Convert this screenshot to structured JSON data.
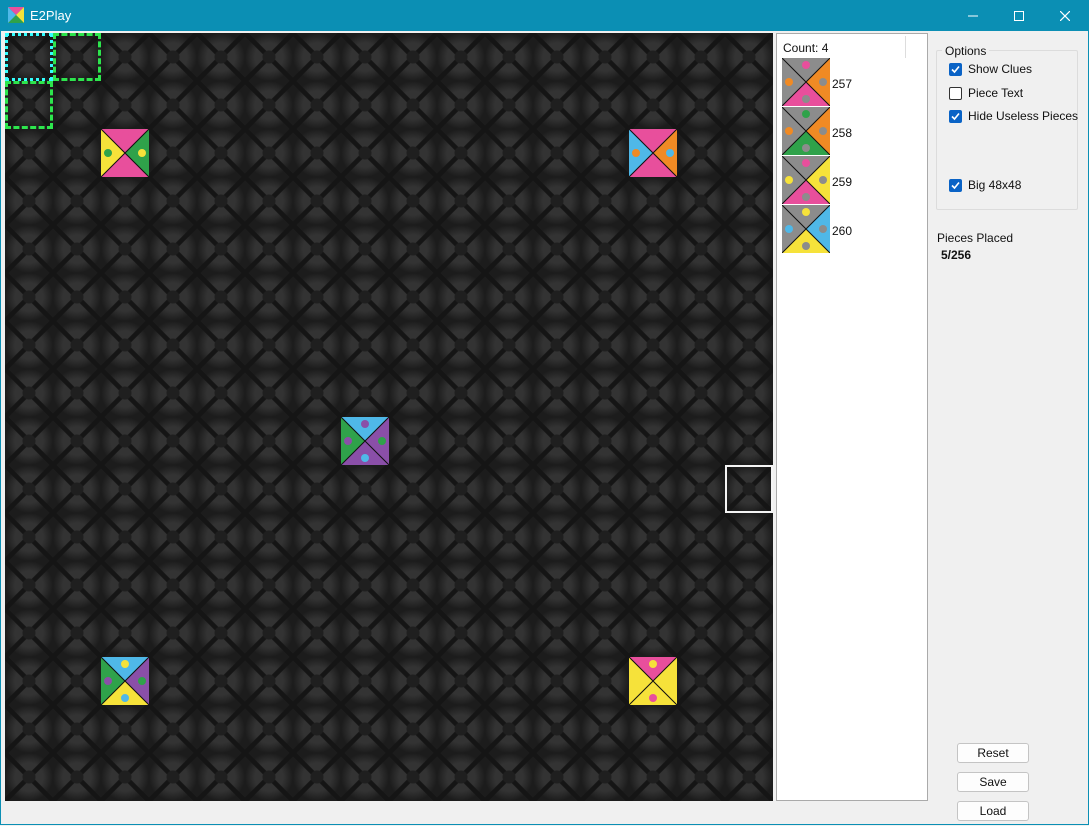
{
  "window": {
    "title": "E2Play"
  },
  "board": {
    "size": 16
  },
  "highlights": [
    {
      "kind": "cyan",
      "row": 0,
      "col": 0
    },
    {
      "kind": "green",
      "row": 0,
      "col": 1
    },
    {
      "kind": "green",
      "row": 1,
      "col": 0
    },
    {
      "kind": "white",
      "row": 9,
      "col": 15
    }
  ],
  "placed_tiles": [
    {
      "row": 2,
      "col": 2,
      "colors": [
        "#e84f9c",
        "#2fa24a",
        "#e84f9c",
        "#f6e23a"
      ]
    },
    {
      "row": 2,
      "col": 13,
      "colors": [
        "#e84f9c",
        "#f08a24",
        "#e84f9c",
        "#4fb8e8"
      ]
    },
    {
      "row": 8,
      "col": 7,
      "colors": [
        "#4fb8e8",
        "#8a4fa8",
        "#8a4fa8",
        "#2fa24a"
      ]
    },
    {
      "row": 13,
      "col": 2,
      "colors": [
        "#4fb8e8",
        "#8a4fa8",
        "#f6e23a",
        "#2fa24a"
      ]
    },
    {
      "row": 13,
      "col": 13,
      "colors": [
        "#e84f9c",
        "#f6e23a",
        "#f6e23a",
        "#f6e23a"
      ]
    }
  ],
  "piece_list": {
    "count_label": "Count: 4",
    "items": [
      {
        "label": "257",
        "colors": [
          "#8c8c8c",
          "#f08a24",
          "#e84f9c",
          "#8c8c8c"
        ]
      },
      {
        "label": "258",
        "colors": [
          "#8c8c8c",
          "#f08a24",
          "#2fa24a",
          "#8c8c8c"
        ]
      },
      {
        "label": "259",
        "colors": [
          "#8c8c8c",
          "#f6e23a",
          "#e84f9c",
          "#8c8c8c"
        ]
      },
      {
        "label": "260",
        "colors": [
          "#8c8c8c",
          "#4fb8e8",
          "#f6e23a",
          "#8c8c8c"
        ]
      }
    ]
  },
  "options": {
    "legend": "Options",
    "show_clues": {
      "label": "Show Clues",
      "checked": true
    },
    "piece_text": {
      "label": "Piece Text",
      "checked": false
    },
    "hide_useless": {
      "label": "Hide Useless Pieces",
      "checked": true
    },
    "big": {
      "label": "Big 48x48",
      "checked": true
    }
  },
  "status": {
    "placed_label": "Pieces Placed",
    "placed_value": "5/256"
  },
  "buttons": {
    "reset": "Reset",
    "save": "Save",
    "load": "Load"
  }
}
